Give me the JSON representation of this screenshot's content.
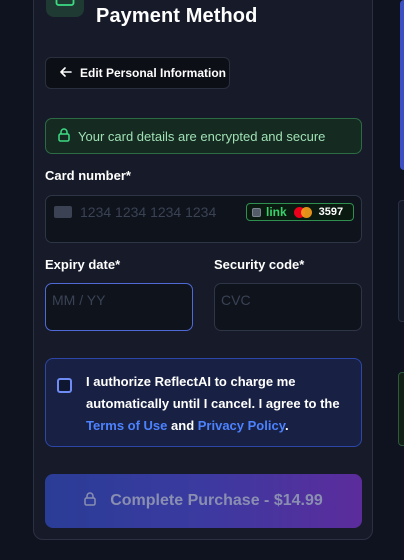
{
  "header": {
    "title": "Payment Method"
  },
  "back_button": {
    "label": "Edit Personal Information"
  },
  "secure_banner": {
    "text": "Your card details are encrypted and secure"
  },
  "card_number": {
    "label": "Card number*",
    "placeholder": "1234 1234 1234 1234",
    "link_label": "link",
    "saved_last4": "3597"
  },
  "expiry": {
    "label": "Expiry date*",
    "placeholder": "MM / YY"
  },
  "security_code": {
    "label": "Security code*",
    "placeholder": "CVC"
  },
  "authorization": {
    "text_before": "I authorize ReflectAI to charge me automatically until I cancel. I agree to the ",
    "terms_link": "Terms of Use",
    "and": " and ",
    "privacy_link": "Privacy Policy",
    "period": ".",
    "checked": false
  },
  "submit": {
    "label": "Complete Purchase - $14.99"
  },
  "colors": {
    "accent_green": "#37d26a",
    "accent_blue": "#4d82ff",
    "gradient_start": "#2a3d96",
    "gradient_end": "#5c2c9c"
  },
  "icons": [
    "card-icon",
    "arrow-left-icon",
    "lock-icon",
    "card-brand-icon",
    "mastercard-icon"
  ]
}
